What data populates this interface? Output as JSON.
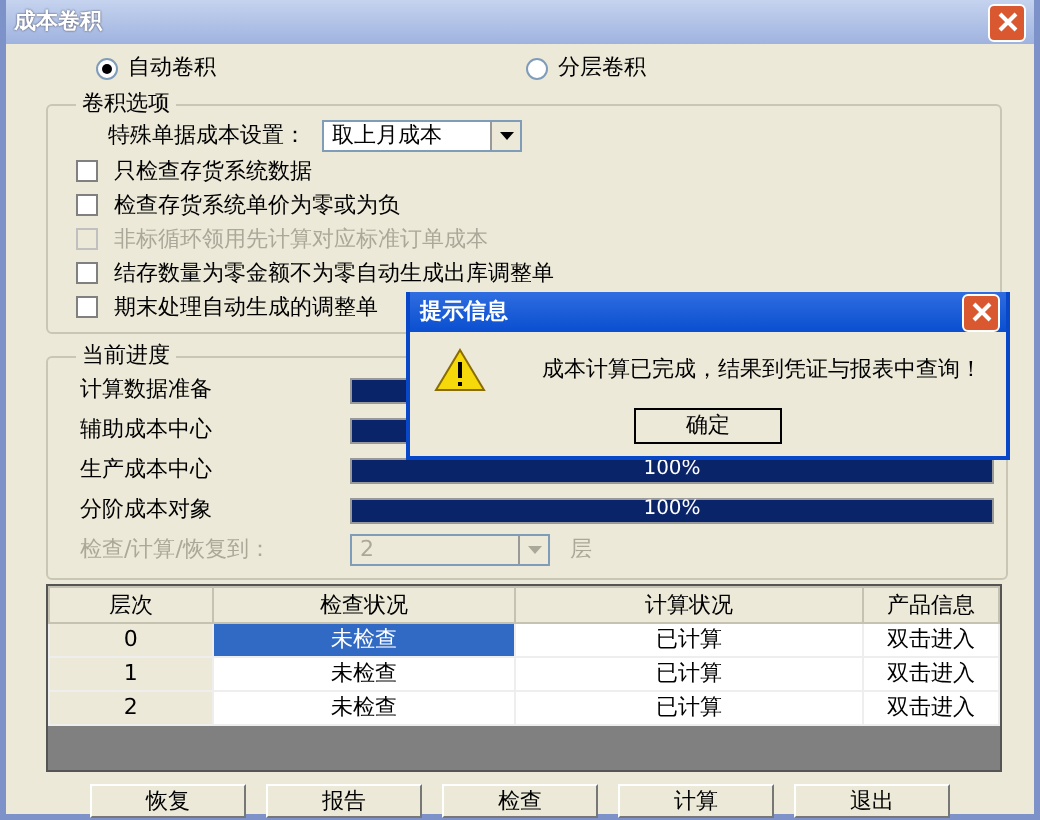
{
  "window": {
    "title": "成本卷积"
  },
  "modes": [
    {
      "label": "自动卷积",
      "selected": true
    },
    {
      "label": "分层卷积",
      "selected": false
    }
  ],
  "options": {
    "title": "卷积选项",
    "special_cost": {
      "label": "特殊单据成本设置：",
      "value": "取上月成本"
    },
    "checkboxes": [
      {
        "label": "只检查存货系统数据",
        "checked": false,
        "disabled": false
      },
      {
        "label": "检查存货系统单价为零或为负",
        "checked": false,
        "disabled": false
      },
      {
        "label": "非标循环领用先计算对应标准订单成本",
        "checked": false,
        "disabled": true
      },
      {
        "label": "结存数量为零金额不为零自动生成出库调整单",
        "checked": false,
        "disabled": false
      },
      {
        "label": "期末处理自动生成的调整单",
        "checked": false,
        "disabled": false
      }
    ]
  },
  "progress": {
    "title": "当前进度",
    "bars": [
      {
        "name": "计算数据准备",
        "level": 1
      },
      {
        "name": "辅助成本中心",
        "level": 1
      },
      {
        "name": "生产成本中心",
        "level": 1,
        "reading": "100%"
      },
      {
        "name": "分阶成本对象",
        "level": 1,
        "reading": "100%"
      }
    ],
    "level_select": {
      "label": "检查/计算/恢复到：",
      "value": "2",
      "unit": "层",
      "disabled": true
    }
  },
  "table": {
    "columns": [
      "层次",
      "检查状况",
      "计算状况",
      "产品信息"
    ],
    "rows": [
      {
        "cells": [
          "0",
          "未检查",
          "已计算",
          "双击进入"
        ],
        "selected": true
      },
      {
        "cells": [
          "1",
          "未检查",
          "已计算",
          "双击进入"
        ],
        "selected": false
      },
      {
        "cells": [
          "2",
          "未检查",
          "已计算",
          "双击进入"
        ],
        "selected": false
      }
    ]
  },
  "buttons": [
    "恢复",
    "报告",
    "检查",
    "计算",
    "退出"
  ],
  "dialog": {
    "title": "提示信息",
    "message": "成本计算已完成，结果到凭证与报表中查询！",
    "buttons": [
      "确定"
    ]
  }
}
